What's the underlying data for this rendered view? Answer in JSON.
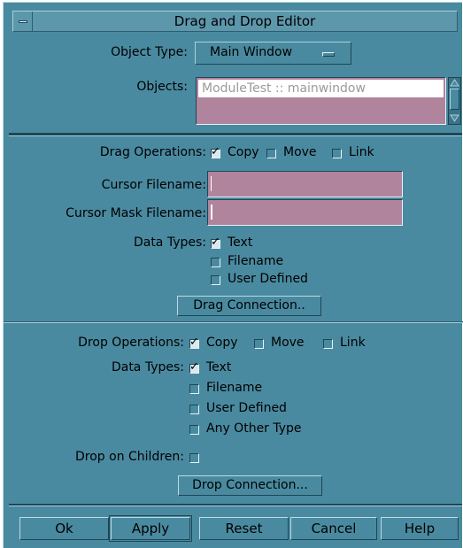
{
  "window": {
    "title": "Drag and Drop Editor"
  },
  "object_type": {
    "label": "Object Type:",
    "value": "Main Window"
  },
  "objects": {
    "label": "Objects:",
    "items": [
      "ModuleTest :: mainwindow"
    ]
  },
  "drag": {
    "operations_label": "Drag Operations:",
    "operations": [
      {
        "label": "Copy",
        "checked": true
      },
      {
        "label": "Move",
        "checked": false
      },
      {
        "label": "Link",
        "checked": false
      }
    ],
    "cursor_filename_label": "Cursor Filename:",
    "cursor_filename_value": "",
    "cursor_mask_label": "Cursor Mask Filename:",
    "cursor_mask_value": "",
    "data_types_label": "Data Types:",
    "data_types": [
      {
        "label": "Text",
        "checked": true
      },
      {
        "label": "Filename",
        "checked": false
      },
      {
        "label": "User Defined",
        "checked": false
      }
    ],
    "connection_button": "Drag Connection.."
  },
  "drop": {
    "operations_label": "Drop Operations:",
    "operations": [
      {
        "label": "Copy",
        "checked": true
      },
      {
        "label": "Move",
        "checked": false
      },
      {
        "label": "Link",
        "checked": false
      }
    ],
    "data_types_label": "Data Types:",
    "data_types": [
      {
        "label": "Text",
        "checked": true
      },
      {
        "label": "Filename",
        "checked": false
      },
      {
        "label": "User Defined",
        "checked": false
      },
      {
        "label": "Any Other Type",
        "checked": false
      }
    ],
    "children_label": "Drop on Children:",
    "children_checked": false,
    "connection_button": "Drop Connection..."
  },
  "buttons": {
    "ok": "Ok",
    "apply": "Apply",
    "reset": "Reset",
    "cancel": "Cancel",
    "help": "Help"
  },
  "colors": {
    "background": "#4a8aa0",
    "field": "#b0849d",
    "highlight": "#ffffff"
  }
}
